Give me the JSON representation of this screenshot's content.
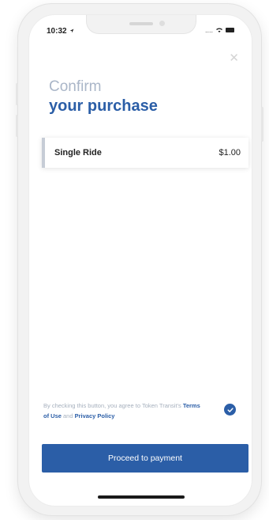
{
  "status_bar": {
    "time": "10:32",
    "signal_text": "...."
  },
  "header": {
    "title_line1": "Confirm",
    "title_line2": "your purchase"
  },
  "order": {
    "items": [
      {
        "name": "Single Ride",
        "price": "$1.00"
      }
    ]
  },
  "agreement": {
    "text_before": "By checking this button, you agree to Token Transit's ",
    "terms_link": "Terms of Use",
    "text_middle": " and ",
    "privacy_link": "Privacy Policy",
    "checked": true
  },
  "actions": {
    "proceed_label": "Proceed to payment"
  },
  "icons": {
    "close": "close-icon",
    "check": "check-icon",
    "location": "location-arrow-icon",
    "wifi": "wifi-icon",
    "battery": "battery-icon"
  },
  "colors": {
    "accent": "#2b5ea7",
    "title_light": "#aab6c8",
    "muted_text": "#a6b0bd",
    "card_border": "#c6ccd6"
  }
}
